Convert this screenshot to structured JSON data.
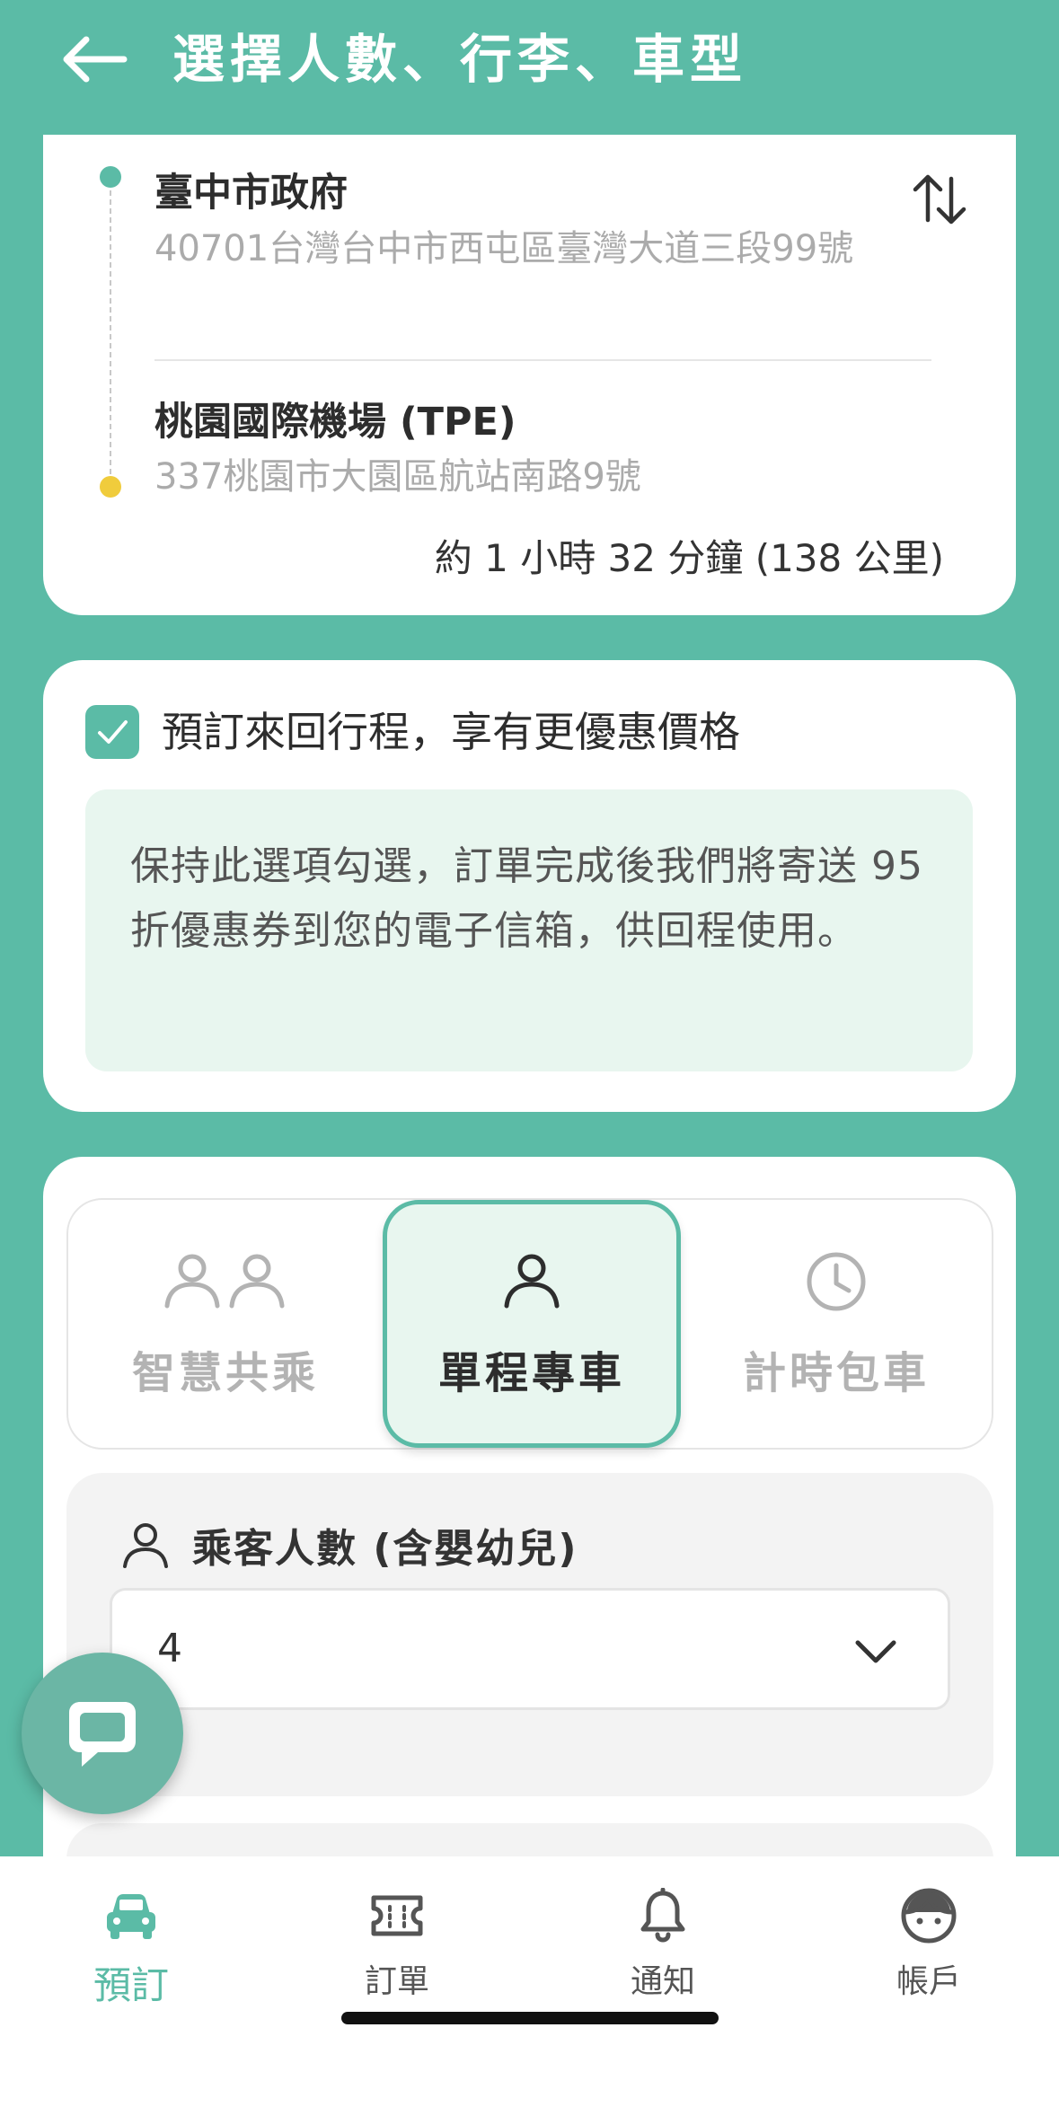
{
  "header": {
    "title": "選擇人數、行李、車型"
  },
  "route": {
    "from": {
      "name": "臺中市政府",
      "address": "40701台灣台中市西屯區臺灣大道三段99號"
    },
    "to": {
      "name": "桃園國際機場 (TPE)",
      "address": "337桃園市大園區航站南路9號"
    },
    "summary": "約 1 小時 32 分鐘 (138 公里)"
  },
  "roundtrip": {
    "checked": true,
    "label": "預訂來回行程，享有更優惠價格",
    "info": "保持此選項勾選，訂單完成後我們將寄送 95 折優惠券到您的電子信箱，供回程使用。"
  },
  "service_tabs": [
    {
      "label": "智慧共乘",
      "icon": "two-people-icon",
      "active": false
    },
    {
      "label": "單程專車",
      "icon": "person-icon",
      "active": true
    },
    {
      "label": "計時包車",
      "icon": "clock-icon",
      "active": false
    }
  ],
  "passengers": {
    "label": "乘客人數 (含嬰幼兒)",
    "value": "4"
  },
  "bottom_nav": [
    {
      "label": "預訂",
      "icon": "car-icon",
      "active": true
    },
    {
      "label": "訂單",
      "icon": "ticket-icon",
      "active": false
    },
    {
      "label": "通知",
      "icon": "bell-icon",
      "active": false
    },
    {
      "label": "帳戶",
      "icon": "face-icon",
      "active": false
    }
  ],
  "colors": {
    "brand": "#5bbba6",
    "brand_light": "#e8f6ef",
    "destination_dot": "#f0cc3c"
  }
}
